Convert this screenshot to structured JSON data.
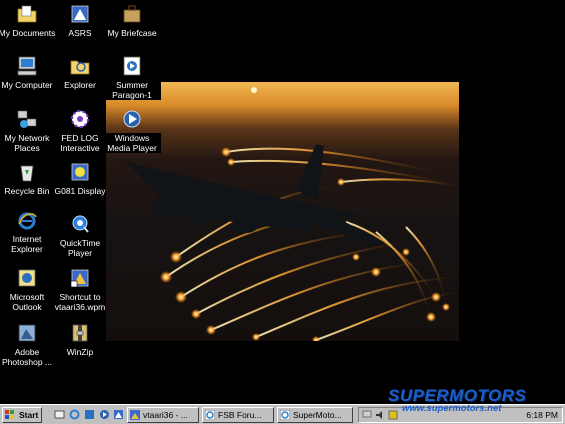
{
  "desktop": {
    "icons": [
      {
        "label": "My Documents",
        "icon": "folder-documents-icon"
      },
      {
        "label": "ASRS",
        "icon": "program-icon"
      },
      {
        "label": "My Briefcase",
        "icon": "briefcase-icon"
      },
      {
        "label": "My Computer",
        "icon": "computer-icon"
      },
      {
        "label": "Explorer",
        "icon": "explorer-icon"
      },
      {
        "label": "Summer Paragon-1",
        "icon": "media-file-icon"
      },
      {
        "label": "My Network Places",
        "icon": "network-icon"
      },
      {
        "label": "FED LOG Interactive",
        "icon": "fedlog-icon"
      },
      {
        "label": "Windows Media Player",
        "icon": "media-player-icon"
      },
      {
        "label": "Recycle Bin",
        "icon": "recycle-bin-icon"
      },
      {
        "label": "G081 Display",
        "icon": "program-icon"
      },
      {
        "label": "Internet Explorer",
        "icon": "ie-icon"
      },
      {
        "label": "QuickTime Player",
        "icon": "quicktime-icon"
      },
      {
        "label": "Microsoft Outlook",
        "icon": "outlook-icon"
      },
      {
        "label": "Shortcut to vtaari36.wpm",
        "icon": "shortcut-icon"
      },
      {
        "label": "Adobe Photoshop ...",
        "icon": "photoshop-icon"
      },
      {
        "label": "WinZip",
        "icon": "winzip-icon"
      }
    ]
  },
  "taskbar": {
    "start_label": "Start",
    "buttons": [
      {
        "label": "vtaari36 - ...",
        "icon": "image-viewer-icon"
      },
      {
        "label": "FSB Foru...",
        "icon": "browser-icon"
      },
      {
        "label": "SuperMoto...",
        "icon": "browser-icon"
      }
    ],
    "clock": "6:18 PM"
  },
  "watermark": {
    "brand": "SUPERMOTORS",
    "url": "www.supermotors.net"
  },
  "colors": {
    "taskbar": "#c0c0c0",
    "desktop": "#000000",
    "watermark": "#1d5fc9"
  }
}
